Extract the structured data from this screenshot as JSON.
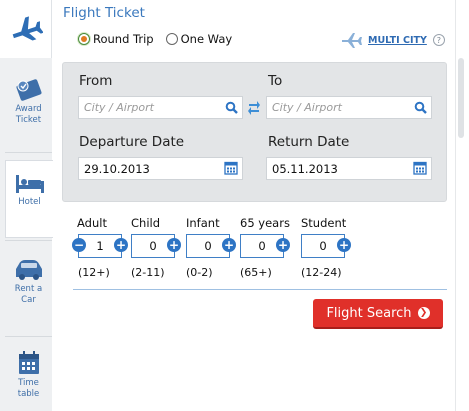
{
  "title": "Flight Ticket",
  "trip_type": {
    "selected": "round_trip",
    "round_trip_label": "Round Trip",
    "one_way_label": "One Way"
  },
  "multi_city_label": "MULTI CITY",
  "multi_city_help": "?",
  "sidebar": {
    "items": [
      {
        "icon": "award-ticket-icon",
        "label1": "Award",
        "label2": "Ticket"
      },
      {
        "icon": "hotel-bed-icon",
        "label1": "Hotel",
        "label2": ""
      },
      {
        "icon": "car-icon",
        "label1": "Rent a",
        "label2": "Car"
      },
      {
        "icon": "calendar-icon",
        "label1": "Time",
        "label2": "table"
      }
    ]
  },
  "search": {
    "from_label": "From",
    "to_label": "To",
    "from_placeholder": "City / Airport",
    "to_placeholder": "City / Airport",
    "departure_label": "Departure Date",
    "return_label": "Return Date",
    "departure_value": "29.10.2013",
    "return_value": "05.11.2013"
  },
  "passengers": [
    {
      "label": "Adult",
      "value": "1",
      "age": "(12+)"
    },
    {
      "label": "Child",
      "value": "0",
      "age": "(2-11)"
    },
    {
      "label": "Infant",
      "value": "0",
      "age": "(0-2)"
    },
    {
      "label": "65 years",
      "value": "0",
      "age": "(65+)"
    },
    {
      "label": "Student",
      "value": "0",
      "age": "(12-24)"
    }
  ],
  "minus_symbol": "−",
  "plus_symbol": "+",
  "search_button_label": "Flight Search",
  "colors": {
    "accent_blue": "#3a78bd",
    "button_red": "#e0302a",
    "panel_gray": "#e3e5e7"
  }
}
